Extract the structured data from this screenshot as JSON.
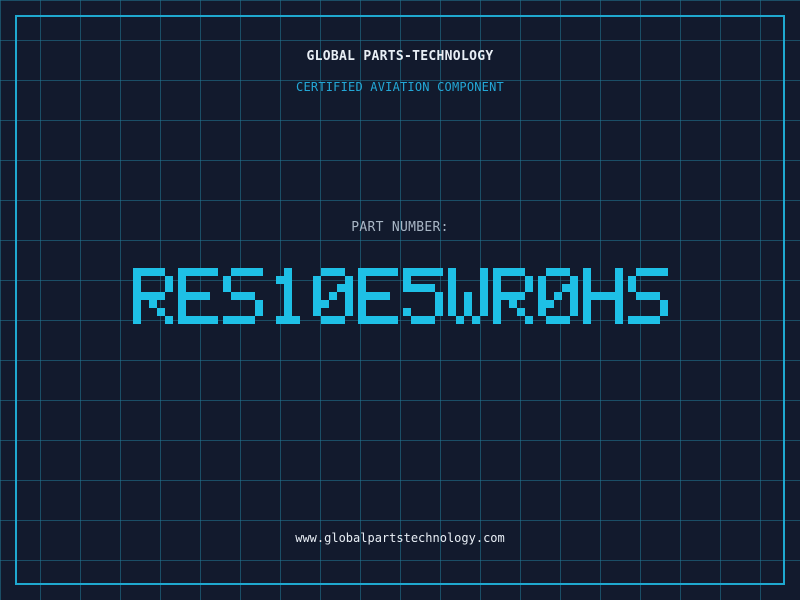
{
  "brand": {
    "company": "GLOBAL PARTS-TECHNOLOGY",
    "subtitle": "CERTIFIED AVIATION COMPONENT"
  },
  "part": {
    "label": "PART NUMBER:",
    "number": "RES10E5WR0HS"
  },
  "footer": {
    "website": "www.globalpartstechnology.com"
  },
  "colors": {
    "background": "#121a2d",
    "grid": "#22789a",
    "frame": "#1fa8cf",
    "accent": "#23a7d6",
    "part_number": "#1ec0e6",
    "text": "#e8eef5",
    "muted": "#a9b6c5"
  }
}
